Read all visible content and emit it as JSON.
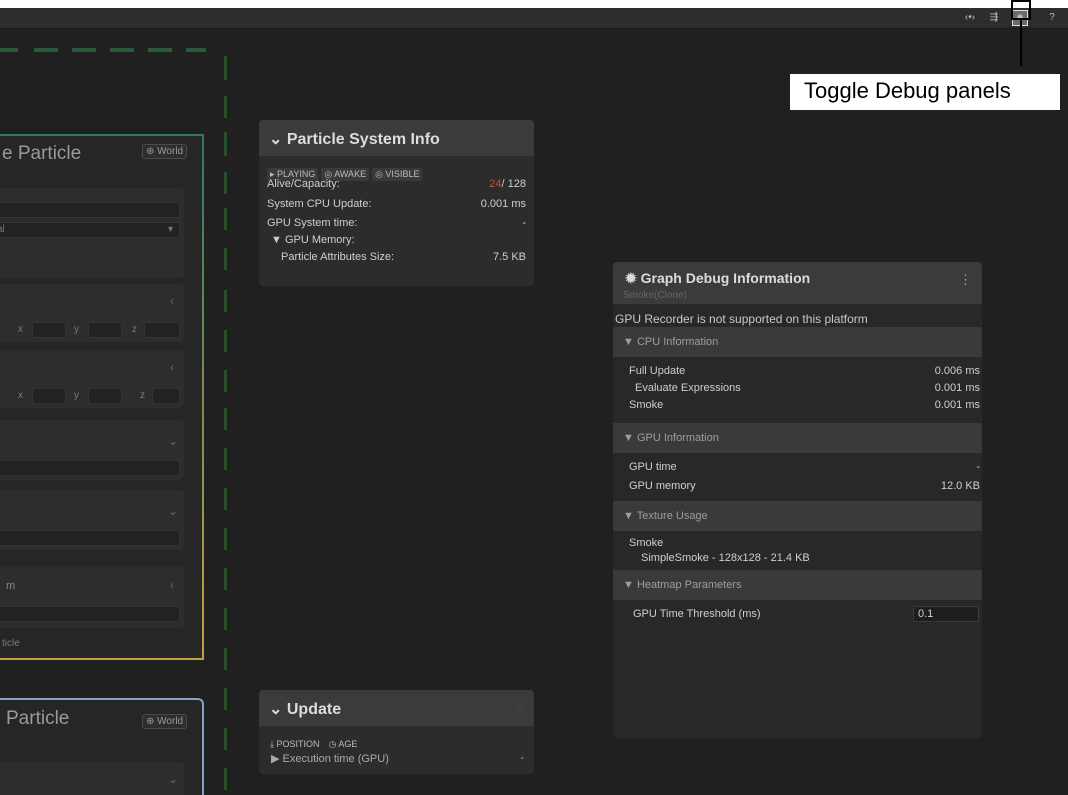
{
  "annotation": {
    "text": "Toggle Debug panels"
  },
  "toolbar": {
    "icons": [
      "code-icon",
      "graph-icon",
      "bug-icon",
      "help-icon"
    ],
    "glyphs": [
      "‹•›",
      "⇶",
      "✹",
      "?"
    ]
  },
  "left_nodes": {
    "node1": {
      "title": "e Particle",
      "world": "World",
      "field_a": "al",
      "axis_x": "x",
      "axis_y": "y",
      "axis_z": "z",
      "label_m": "m",
      "footer": "ticle"
    },
    "node2": {
      "title": "Particle",
      "world": "World"
    }
  },
  "particle_info": {
    "title": "Particle System Info",
    "tags": [
      "▸ PLAYING",
      "◎ AWAKE",
      "◎ VISIBLE"
    ],
    "rows": [
      {
        "label": "Alive/Capacity:",
        "alive": "24",
        "capacity": "/ 128"
      },
      {
        "label": "System CPU Update:",
        "value": "0.001 ms"
      },
      {
        "label": "GPU System time:",
        "value": "-"
      },
      {
        "label": "▼ GPU Memory:",
        "value": ""
      },
      {
        "label": "Particle Attributes Size:",
        "value": "7.5 KB"
      }
    ]
  },
  "update_panel": {
    "title": "Update",
    "tags": [
      "⤓ POSITION",
      "◷ AGE"
    ],
    "exec_label": "▶ Execution time (GPU)",
    "exec_value": "-"
  },
  "debug_info": {
    "title": "Graph Debug Information",
    "subtitle": "Smoke(Clone)",
    "warning": "GPU Recorder is not supported on this platform",
    "sections": {
      "cpu": "▼ CPU Information",
      "gpu": "▼ GPU Information",
      "texture": "▼ Texture Usage",
      "heatmap": "▼ Heatmap Parameters"
    },
    "cpu_rows": [
      {
        "label": "Full Update",
        "value": "0.006 ms"
      },
      {
        "label": "Evaluate Expressions",
        "value": "0.001 ms"
      },
      {
        "label": "Smoke",
        "value": "0.001 ms"
      }
    ],
    "gpu_rows": [
      {
        "label": "GPU time",
        "value": "-"
      },
      {
        "label": "GPU memory",
        "value": "12.0 KB"
      }
    ],
    "texture_rows": {
      "name": "Smoke",
      "detail": "SimpleSmoke - 128x128 - 21.4 KB"
    },
    "heatmap": {
      "label": "GPU Time Threshold (ms)",
      "value": "0.1"
    },
    "menu_glyph": "⋮"
  }
}
